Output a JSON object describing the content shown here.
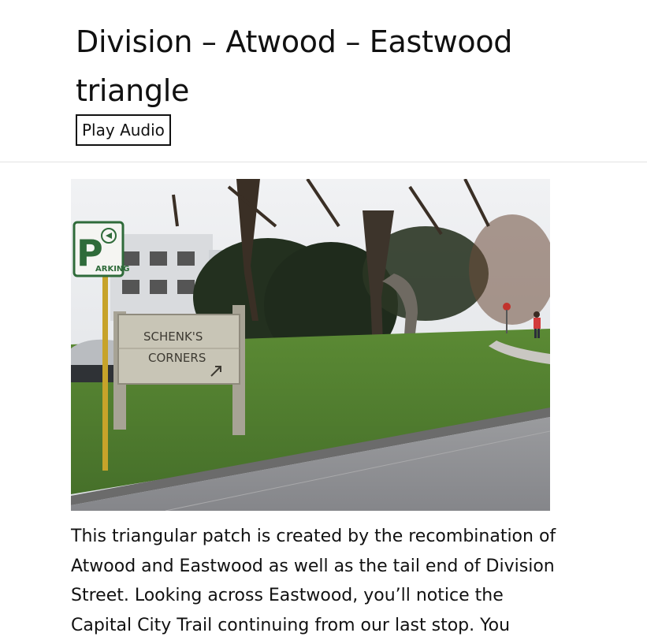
{
  "page": {
    "title": "Division – Atwood – Eastwood triangle",
    "audio_button_label": "Play Audio"
  },
  "photo": {
    "sign_parking_letter": "P",
    "sign_parking_text": "ARKING",
    "sign_line1": "SCHENK'S",
    "sign_line2": "CORNERS"
  },
  "article": {
    "paragraph": "This triangular patch is created by the recombination of Atwood and Eastwood as well as the tail end of Division Street. Looking across Eastwood, you’ll notice the Capital City Trail continuing from our last stop. You"
  },
  "colors": {
    "grass": "#4f7a2a",
    "road": "#8d8e90",
    "sky": "#e6e8ec"
  }
}
